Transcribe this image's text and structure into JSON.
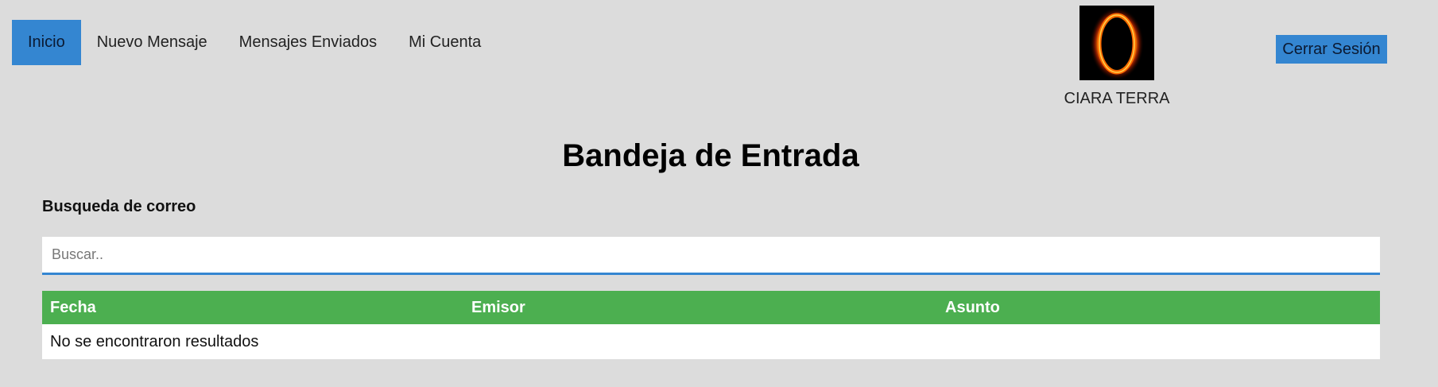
{
  "nav": {
    "items": [
      {
        "label": "Inicio",
        "active": true
      },
      {
        "label": "Nuevo Mensaje",
        "active": false
      },
      {
        "label": "Mensajes Enviados",
        "active": false
      },
      {
        "label": "Mi Cuenta",
        "active": false
      }
    ]
  },
  "profile": {
    "username": "CIARA TERRA",
    "avatar_icon": "fire-ring-avatar"
  },
  "header": {
    "logout_label": "Cerrar Sesión"
  },
  "main": {
    "title": "Bandeja de Entrada",
    "search_label": "Busqueda de correo",
    "search_placeholder": "Buscar..",
    "search_value": ""
  },
  "table": {
    "columns": [
      "Fecha",
      "Emisor",
      "Asunto"
    ],
    "empty_message": "No se encontraron resultados"
  },
  "colors": {
    "background": "#dcdcdc",
    "accent_blue": "#3486d1",
    "header_green": "#4caf50"
  }
}
